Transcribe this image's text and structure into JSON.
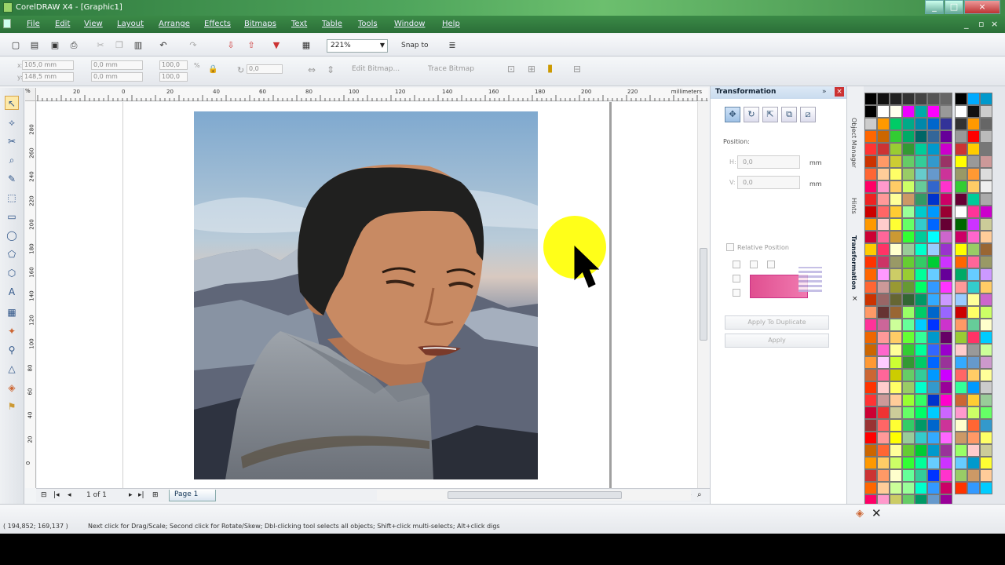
{
  "window": {
    "title": "CorelDRAW X4 - [Graphic1]",
    "min": "_",
    "max": "□",
    "close": "×"
  },
  "menu": {
    "items": [
      "File",
      "Edit",
      "View",
      "Layout",
      "Arrange",
      "Effects",
      "Bitmaps",
      "Text",
      "Table",
      "Tools",
      "Window",
      "Help"
    ]
  },
  "toolbar": {
    "zoom": "221%",
    "snap_to": "Snap to"
  },
  "propbar": {
    "x": "105,0 mm",
    "y": "148,5 mm",
    "w": "0,0 mm",
    "h": "0,0 mm",
    "scale_x": "100,0",
    "scale_y": "100,0",
    "rotation": "0,0",
    "edit_bitmap": "Edit Bitmap...",
    "trace_bitmap": "Trace Bitmap"
  },
  "ruler": {
    "unit": "millimeters",
    "h_labels": [
      "20",
      "0",
      "20",
      "40",
      "60",
      "80",
      "100",
      "120",
      "140",
      "160",
      "180",
      "200",
      "220"
    ],
    "v_labels": [
      "280",
      "260",
      "240",
      "220",
      "200",
      "180",
      "160",
      "140",
      "120",
      "100",
      "80",
      "60",
      "40",
      "20",
      "0"
    ]
  },
  "navigation": {
    "page_count": "1 of 1",
    "page_tab": "Page 1"
  },
  "docker": {
    "title": "Transformation",
    "position_label": "Position:",
    "h_label": "H:",
    "v_label": "V:",
    "h_value": "0,0",
    "v_value": "0,0",
    "unit": "mm",
    "relative_position": "Relative Position",
    "apply_to_duplicate": "Apply To Duplicate",
    "apply": "Apply",
    "side_tabs": [
      "Object Manager",
      "Hints",
      "Transformation"
    ]
  },
  "status": {
    "coords": "( 194,852; 169,137 )",
    "hint": "Next click for Drag/Scale; Second click for Rotate/Skew; Dbl-clicking tool selects all objects; Shift+click multi-selects; Alt+click digs"
  },
  "colors": {
    "title_green": "#3b8a47",
    "cursor_highlight": "#ffff00",
    "page_tab_bg": "#dbe6f1"
  },
  "palette1": [
    "#000",
    "#111",
    "#222",
    "#333",
    "#444",
    "#555",
    "#666",
    "#000",
    "#fff",
    "#ffe",
    "#e0f",
    "#0aa",
    "#f0f",
    "#999",
    "#ccc",
    "#f90",
    "#0c6",
    "#0a8",
    "#08a",
    "#06c",
    "#339",
    "#f60",
    "#c60",
    "#3c3",
    "#0a6",
    "#066",
    "#369",
    "#609",
    "#f33",
    "#c33",
    "#9c3",
    "#393",
    "#0c9",
    "#09c",
    "#c0c",
    "#c30",
    "#f96",
    "#cc3",
    "#6c6",
    "#3c9",
    "#39c",
    "#936",
    "#f63",
    "#fc9",
    "#ff6",
    "#9c6",
    "#6cc",
    "#69c",
    "#c39",
    "#f06",
    "#f9c",
    "#fc6",
    "#cf6",
    "#6c9",
    "#36c",
    "#f3c",
    "#e22",
    "#f99",
    "#ff9",
    "#c96",
    "#396",
    "#03c",
    "#c06",
    "#c00",
    "#f66",
    "#fc3",
    "#9f9",
    "#0cc",
    "#09f",
    "#903",
    "#f90",
    "#fcc",
    "#ff3",
    "#6f6",
    "#3cc",
    "#06f",
    "#603",
    "#c03",
    "#f69",
    "#c93",
    "#3f3",
    "#0c9",
    "#0ff",
    "#c6c",
    "#fc0",
    "#f36",
    "#ffc",
    "#9c9",
    "#0fc",
    "#9cf",
    "#93c",
    "#f30",
    "#c36",
    "#996",
    "#6c3",
    "#3c6",
    "#0c3",
    "#c3f",
    "#f60",
    "#f9f",
    "#cc6",
    "#9c3",
    "#0f9",
    "#6cf",
    "#609",
    "#f63",
    "#c99",
    "#993",
    "#693",
    "#0f6",
    "#39f",
    "#f3f",
    "#c30",
    "#966",
    "#663",
    "#363",
    "#096",
    "#3af",
    "#c9f",
    "#f96",
    "#633",
    "#963",
    "#9f6",
    "#0c6",
    "#06c",
    "#96f",
    "#f39",
    "#c69",
    "#cf9",
    "#6f9",
    "#0cf",
    "#03f",
    "#c3c",
    "#e60",
    "#f99",
    "#fc6",
    "#6f3",
    "#3f9",
    "#09c",
    "#606",
    "#c60",
    "#f6c",
    "#ff9",
    "#3c3",
    "#0f9",
    "#36f",
    "#90c",
    "#f93",
    "#fcf",
    "#cf3",
    "#393",
    "#0c6",
    "#06f",
    "#939",
    "#c63",
    "#f69",
    "#cc0",
    "#6c6",
    "#3c9",
    "#09f",
    "#c0f",
    "#f30",
    "#fcc",
    "#ff6",
    "#9c6",
    "#0fc",
    "#39c",
    "#909",
    "#f33",
    "#c99",
    "#fc9",
    "#9f3",
    "#3f6",
    "#03c",
    "#f0c",
    "#c03",
    "#e33",
    "#cc9",
    "#6f6",
    "#0f6",
    "#0cf",
    "#c6f",
    "#933",
    "#f66",
    "#ff3",
    "#3c6",
    "#096",
    "#06c",
    "#c39",
    "#f00",
    "#f99",
    "#ff0",
    "#9c9",
    "#3cc",
    "#3af",
    "#f6f",
    "#c60",
    "#f63",
    "#ff9",
    "#6c3",
    "#0c3",
    "#09c",
    "#939",
    "#f90",
    "#fc6",
    "#cf6",
    "#3f3",
    "#0f9",
    "#6cf",
    "#c3f",
    "#c33",
    "#f96",
    "#ffc",
    "#6f9",
    "#3c9",
    "#03f",
    "#f3c",
    "#f60",
    "#fc9",
    "#cf9",
    "#9f9",
    "#0fc",
    "#39f",
    "#c06",
    "#f06",
    "#f9c",
    "#cc6",
    "#6c6",
    "#096",
    "#69c",
    "#909",
    "#c00",
    "#f66",
    "#fc3",
    "#393",
    "#0c6",
    "#06f",
    "#c0c",
    "#f33",
    "#fcc",
    "#ff6",
    "#9f6",
    "#3f6",
    "#09f",
    "#f3f"
  ],
  "palette2": [
    "#000",
    "#0af",
    "#09c",
    "#fff",
    "#111",
    "#ccc",
    "#333",
    "#f90",
    "#666",
    "#999",
    "#f00",
    "#bbb",
    "#c33",
    "#fc0",
    "#777",
    "#ff0",
    "#999",
    "#c99",
    "#996",
    "#f93",
    "#ddd",
    "#3c3",
    "#fc6",
    "#eee",
    "#603",
    "#0c9",
    "#aaa",
    "#fff",
    "#f39",
    "#c0c",
    "#060",
    "#c3f",
    "#cc9",
    "#c06",
    "#f6c",
    "#fc9",
    "#ff0",
    "#9c6",
    "#963",
    "#f60",
    "#f69",
    "#996",
    "#0a6",
    "#6cf",
    "#c9f",
    "#f99",
    "#3cc",
    "#fc6",
    "#9cf",
    "#ff9",
    "#c6c",
    "#c00",
    "#ff6",
    "#cf6",
    "#f96",
    "#6c9",
    "#ffc",
    "#9c3",
    "#f36",
    "#0cf",
    "#fcc",
    "#999",
    "#cf9",
    "#3af",
    "#69c",
    "#c9c",
    "#f66",
    "#fc6",
    "#ff9",
    "#3f9",
    "#09f",
    "#ccc",
    "#c63",
    "#fc3",
    "#9c9",
    "#f9c",
    "#cf6",
    "#6f6",
    "#ffc",
    "#f63",
    "#39c",
    "#c96",
    "#f96",
    "#ff6",
    "#9f6",
    "#fcc",
    "#cc9",
    "#6cf",
    "#09c",
    "#ff3",
    "#9c6",
    "#c96",
    "#fc9",
    "#f30",
    "#39f",
    "#0cf"
  ]
}
